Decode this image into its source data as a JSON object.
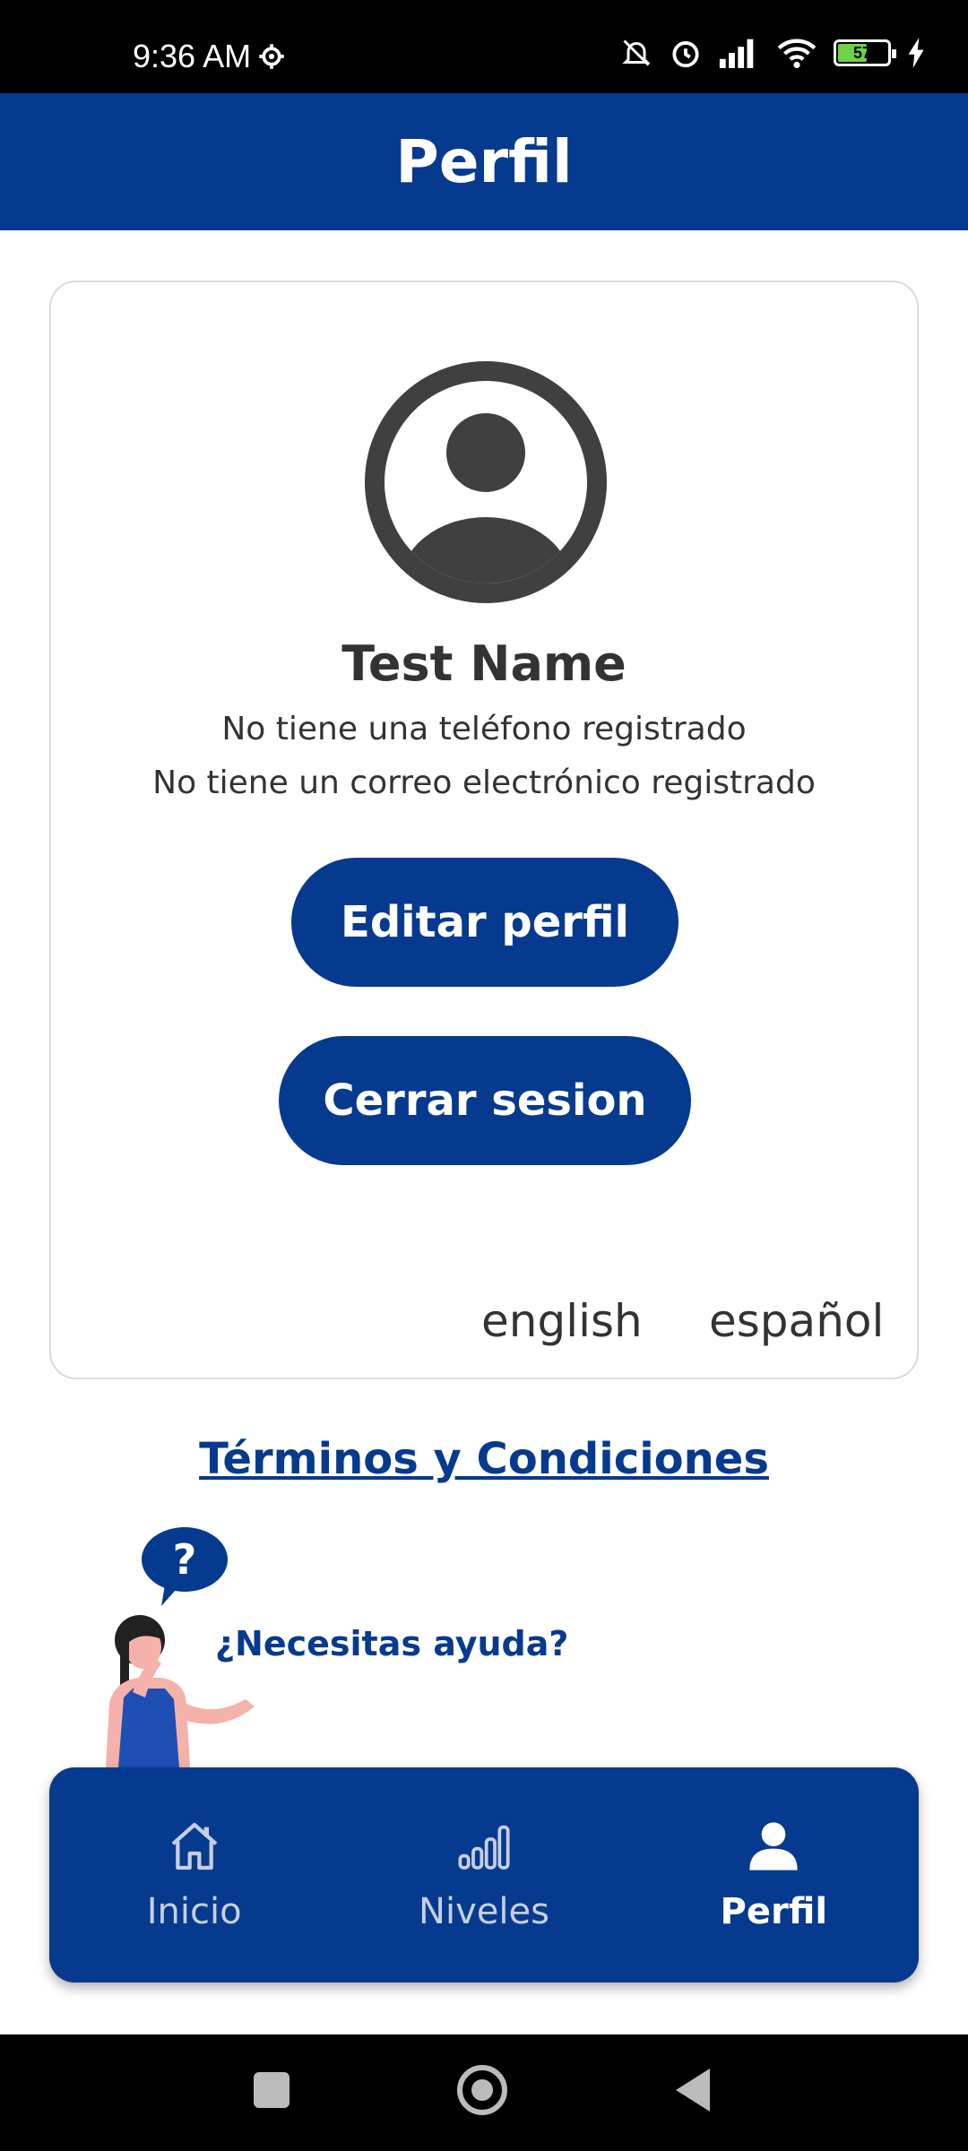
{
  "status": {
    "time": "9:36 AM",
    "battery": "57"
  },
  "header": {
    "title": "Perfil"
  },
  "profile": {
    "name": "Test Name",
    "phone_text": "No tiene una teléfono registrado",
    "email_text": "No tiene un correo electrónico registrado",
    "edit_label": "Editar perfil",
    "logout_label": "Cerrar sesion"
  },
  "languages": [
    "english",
    "español"
  ],
  "terms_label": "Términos y Condiciones",
  "help": {
    "label": "¿Necesitas ayuda?",
    "bubble": "?"
  },
  "nav": [
    {
      "label": "Inicio",
      "icon": "home-icon"
    },
    {
      "label": "Niveles",
      "icon": "levels-icon"
    },
    {
      "label": "Perfil",
      "icon": "profile-icon",
      "active": true
    }
  ],
  "colors": {
    "primary": "#063a8f",
    "text": "#333333"
  }
}
